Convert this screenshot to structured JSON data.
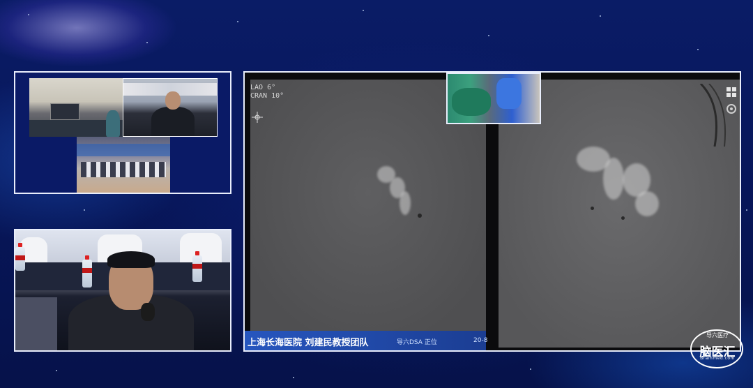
{
  "dsa": {
    "angles": {
      "line1": "LAO    6°",
      "line2": "CRAN  10°"
    },
    "caption": {
      "main": "上海长海医院  刘建民教授团队",
      "mode": "导六DSA 正位",
      "frame": "20-8"
    }
  },
  "logo": {
    "top": "导六医疗",
    "main": "脑医汇",
    "sub": "Brainmed.com"
  },
  "colors": {
    "background": "#07154f",
    "panel_border": "#e9eefc",
    "caption_bar": "#2b5fc8"
  },
  "icons": [
    "grid-icon",
    "settings-icon",
    "crosshair-icon"
  ]
}
